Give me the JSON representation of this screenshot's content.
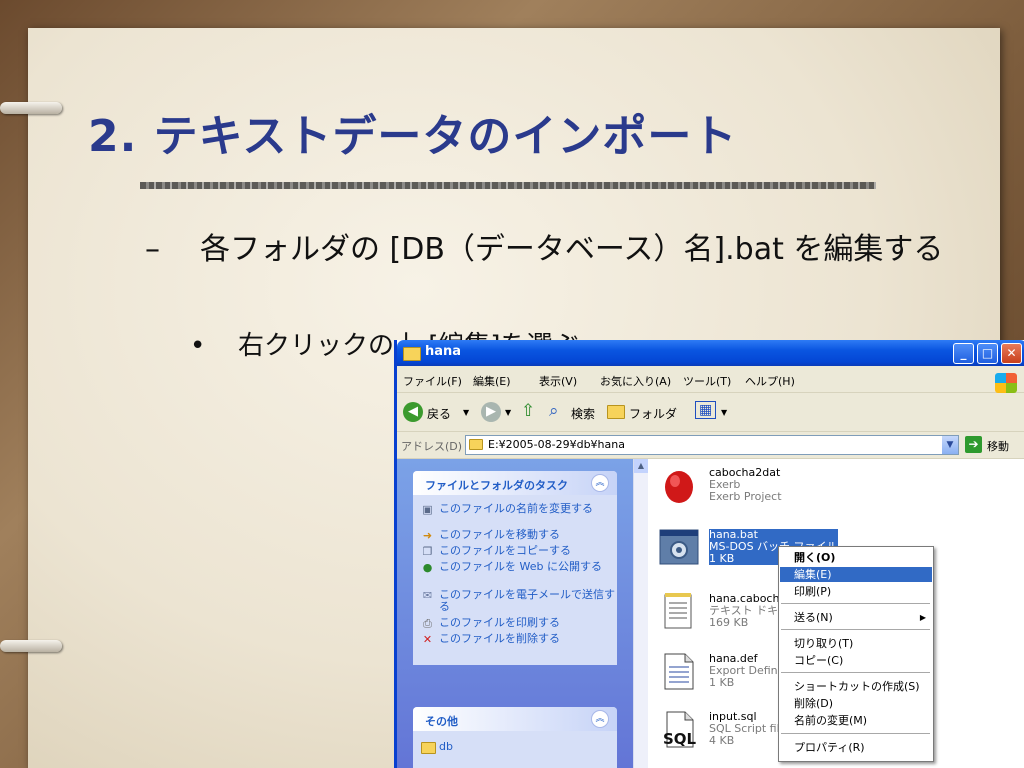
{
  "slide": {
    "title": "2. テキストデータのインポート",
    "bullet1_dash": "–",
    "bullet1": "各フォルダの [DB（データベース）名].bat を編集する",
    "bullet2_dot": "•",
    "bullet2": "右クリックの上 [編集]を選ぶ"
  },
  "window": {
    "title": "hana",
    "controls": [
      "_",
      "□",
      "✕"
    ],
    "menu": [
      "ファイル(F)",
      "編集(E)",
      "表示(V)",
      "お気に入り(A)",
      "ツール(T)",
      "ヘルプ(H)"
    ],
    "toolbar": {
      "back": "戻る",
      "search": "検索",
      "folders": "フォルダ"
    },
    "address": {
      "label": "アドレス(D)",
      "value": "E:¥2005-08-29¥db¥hana",
      "go": "移動"
    }
  },
  "taskpane": {
    "file_tasks_title": "ファイルとフォルダのタスク",
    "file_tasks": [
      "このファイルの名前を変更する",
      "このファイルを移動する",
      "このファイルをコピーする",
      "このファイルを Web に公開する",
      "このファイルを電子メールで送信する",
      "このファイルを印刷する",
      "このファイルを削除する"
    ],
    "other_title": "その他",
    "other_items": [
      "db"
    ]
  },
  "files": [
    {
      "name": "cabocha2dat",
      "line2": "Exerb",
      "line3": "Exerb Project",
      "icon": "ruby-gem-icon"
    },
    {
      "name": "hana.bat",
      "line2": "MS-DOS バッチ ファイル",
      "line3": "1 KB",
      "icon": "batch-gear-icon"
    },
    {
      "name": "hana.cabocha",
      "line2": "テキスト ドキュメント",
      "line3": "169 KB",
      "icon": "text-document-icon"
    },
    {
      "name": "hana.def",
      "line2": "Export Definition",
      "line3": "1 KB",
      "icon": "document-icon"
    },
    {
      "name": "input.sql",
      "line2": "SQL Script file",
      "line3": "4 KB",
      "icon": "sql-file-icon"
    }
  ],
  "context_menu": {
    "items": [
      {
        "label": "開く(O)",
        "bold": true
      },
      {
        "label": "編集(E)",
        "highlighted": true
      },
      {
        "label": "印刷(P)"
      },
      {
        "label": "送る(N)",
        "submenu": true
      },
      {
        "label": "切り取り(T)"
      },
      {
        "label": "コピー(C)"
      },
      {
        "label": "ショートカットの作成(S)"
      },
      {
        "label": "削除(D)"
      },
      {
        "label": "名前の変更(M)"
      },
      {
        "label": "プロパティ(R)"
      }
    ]
  },
  "colors": {
    "title": "#2a3a8c",
    "xp_blue": "#0a55e0",
    "selection": "#316ac5",
    "task_link": "#215dc6"
  }
}
